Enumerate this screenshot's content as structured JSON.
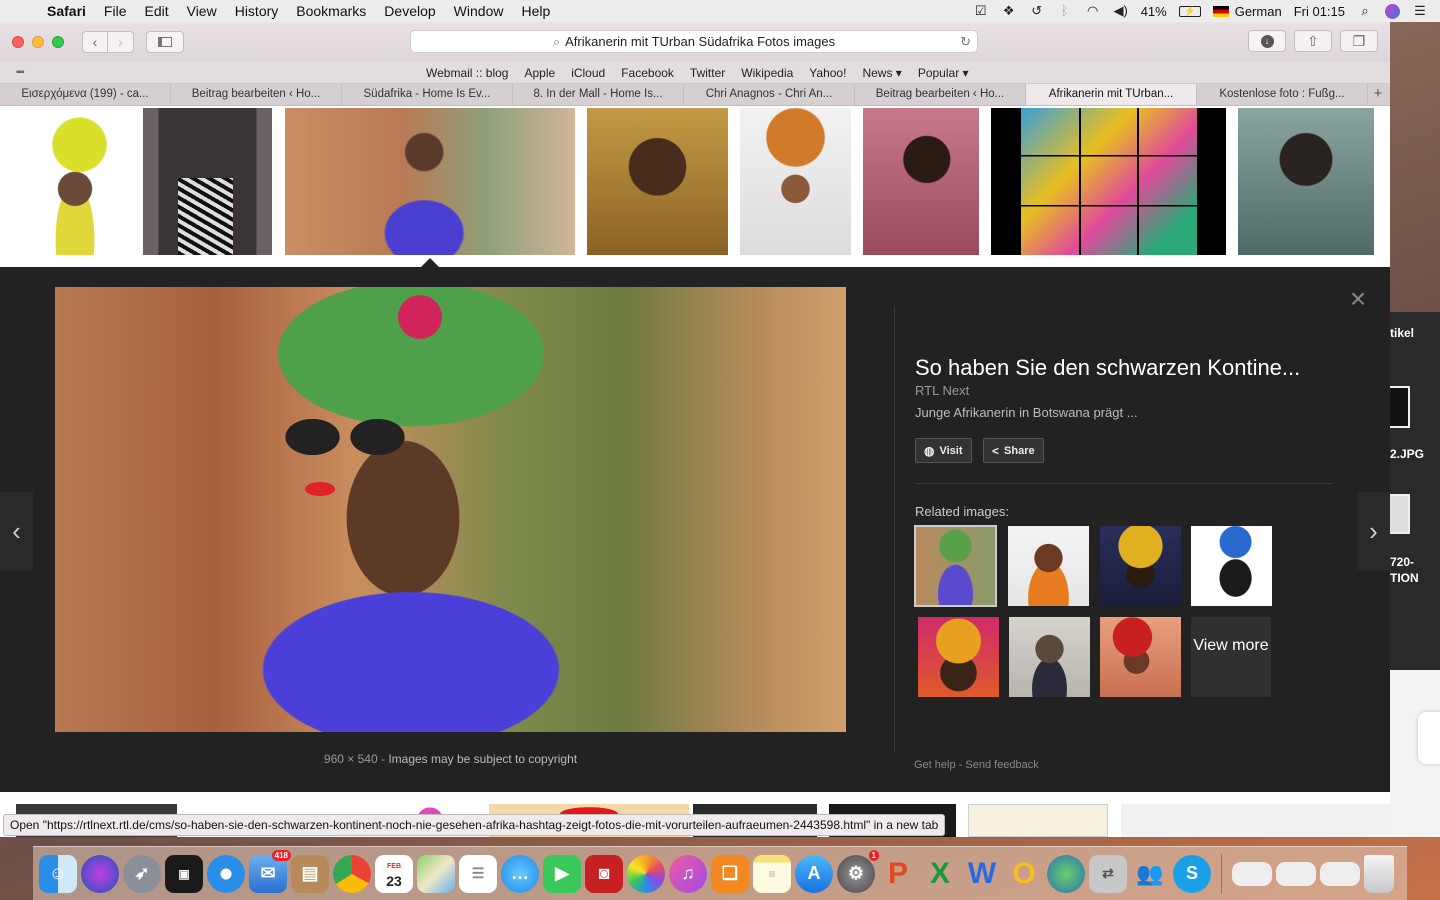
{
  "menubar": {
    "app": "Safari",
    "items": [
      "File",
      "Edit",
      "View",
      "History",
      "Bookmarks",
      "Develop",
      "Window",
      "Help"
    ],
    "battery": "41%",
    "language": "German",
    "clock": "Fri 01:15"
  },
  "toolbar": {
    "url_text": "Afrikanerin mit TUrban  Südafrika Fotos images"
  },
  "favorites": [
    "Webmail :: blog",
    "Apple",
    "iCloud",
    "Facebook",
    "Twitter",
    "Wikipedia",
    "Yahoo!",
    "News ▾",
    "Popular ▾"
  ],
  "tabs": [
    {
      "label": "Εισερχόμενα (199) - ca..."
    },
    {
      "label": "Beitrag bearbeiten ‹ Ho..."
    },
    {
      "label": "Südafrika - Home Is Ev..."
    },
    {
      "label": "8. In der Mall - Home Is..."
    },
    {
      "label": "Chri Anagnos - Chri An..."
    },
    {
      "label": "Beitrag bearbeiten ‹ Ho..."
    },
    {
      "label": "Afrikanerin mit TUrban..."
    },
    {
      "label": "Kostenlose foto : Fußg..."
    }
  ],
  "viewer": {
    "caption_size": "960 × 540",
    "caption_sep": "-",
    "caption_copyright": "Images may be subject to copyright",
    "title": "So haben Sie den schwarzen Kontine...",
    "source": "RTL Next",
    "description": "Junge Afrikanerin in Botswana prägt ...",
    "visit_label": "Visit",
    "share_label": "Share",
    "related_label": "Related images:",
    "view_more": "View more",
    "get_help": "Get help",
    "send_feedback": "Send feedback",
    "footer_sep": "-"
  },
  "status": {
    "text": "Open \"https://rtlnext.rtl.de/cms/so-haben-sie-den-schwarzen-kontinent-noch-nie-gesehen-afrika-hashtag-zeigt-fotos-die-mit-vorurteilen-aufraeumen-2443598.html\" in a new tab"
  },
  "background_peek": {
    "label1": "tikel",
    "label2": "2.JPG",
    "label3": "720-",
    "label4": "TION"
  },
  "dock": {
    "mail_badge": "418",
    "calendar_month": "FEB",
    "calendar_day": "23",
    "sysprefs_badge": "1"
  },
  "colors": {
    "panel_bg": "#222222",
    "menubar_bg": "#ececec",
    "accent_blue": "#1a73e8"
  }
}
